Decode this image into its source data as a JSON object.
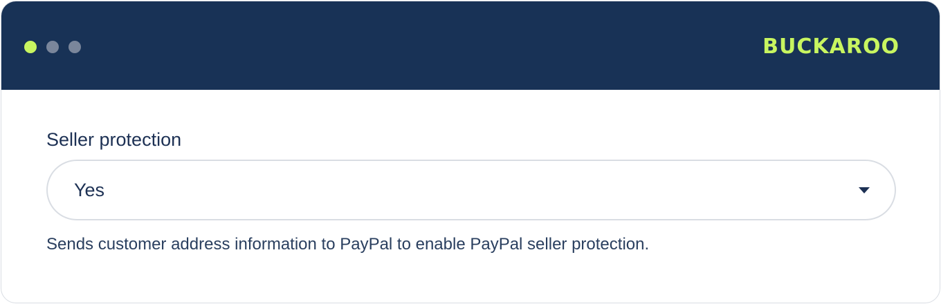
{
  "window": {
    "controls": [
      "active-dot",
      "inactive-dot",
      "inactive-dot"
    ],
    "brand": "BUCKAROO",
    "colors": {
      "titlebar": "#183256",
      "accent": "#c8f560",
      "inactive_dot": "#7a869b",
      "text": "#1d3154"
    }
  },
  "form": {
    "label": "Seller protection",
    "select": {
      "value": "Yes",
      "icon": "caret-down-icon"
    },
    "help_text": "Sends customer address information to PayPal to enable PayPal seller protection."
  }
}
